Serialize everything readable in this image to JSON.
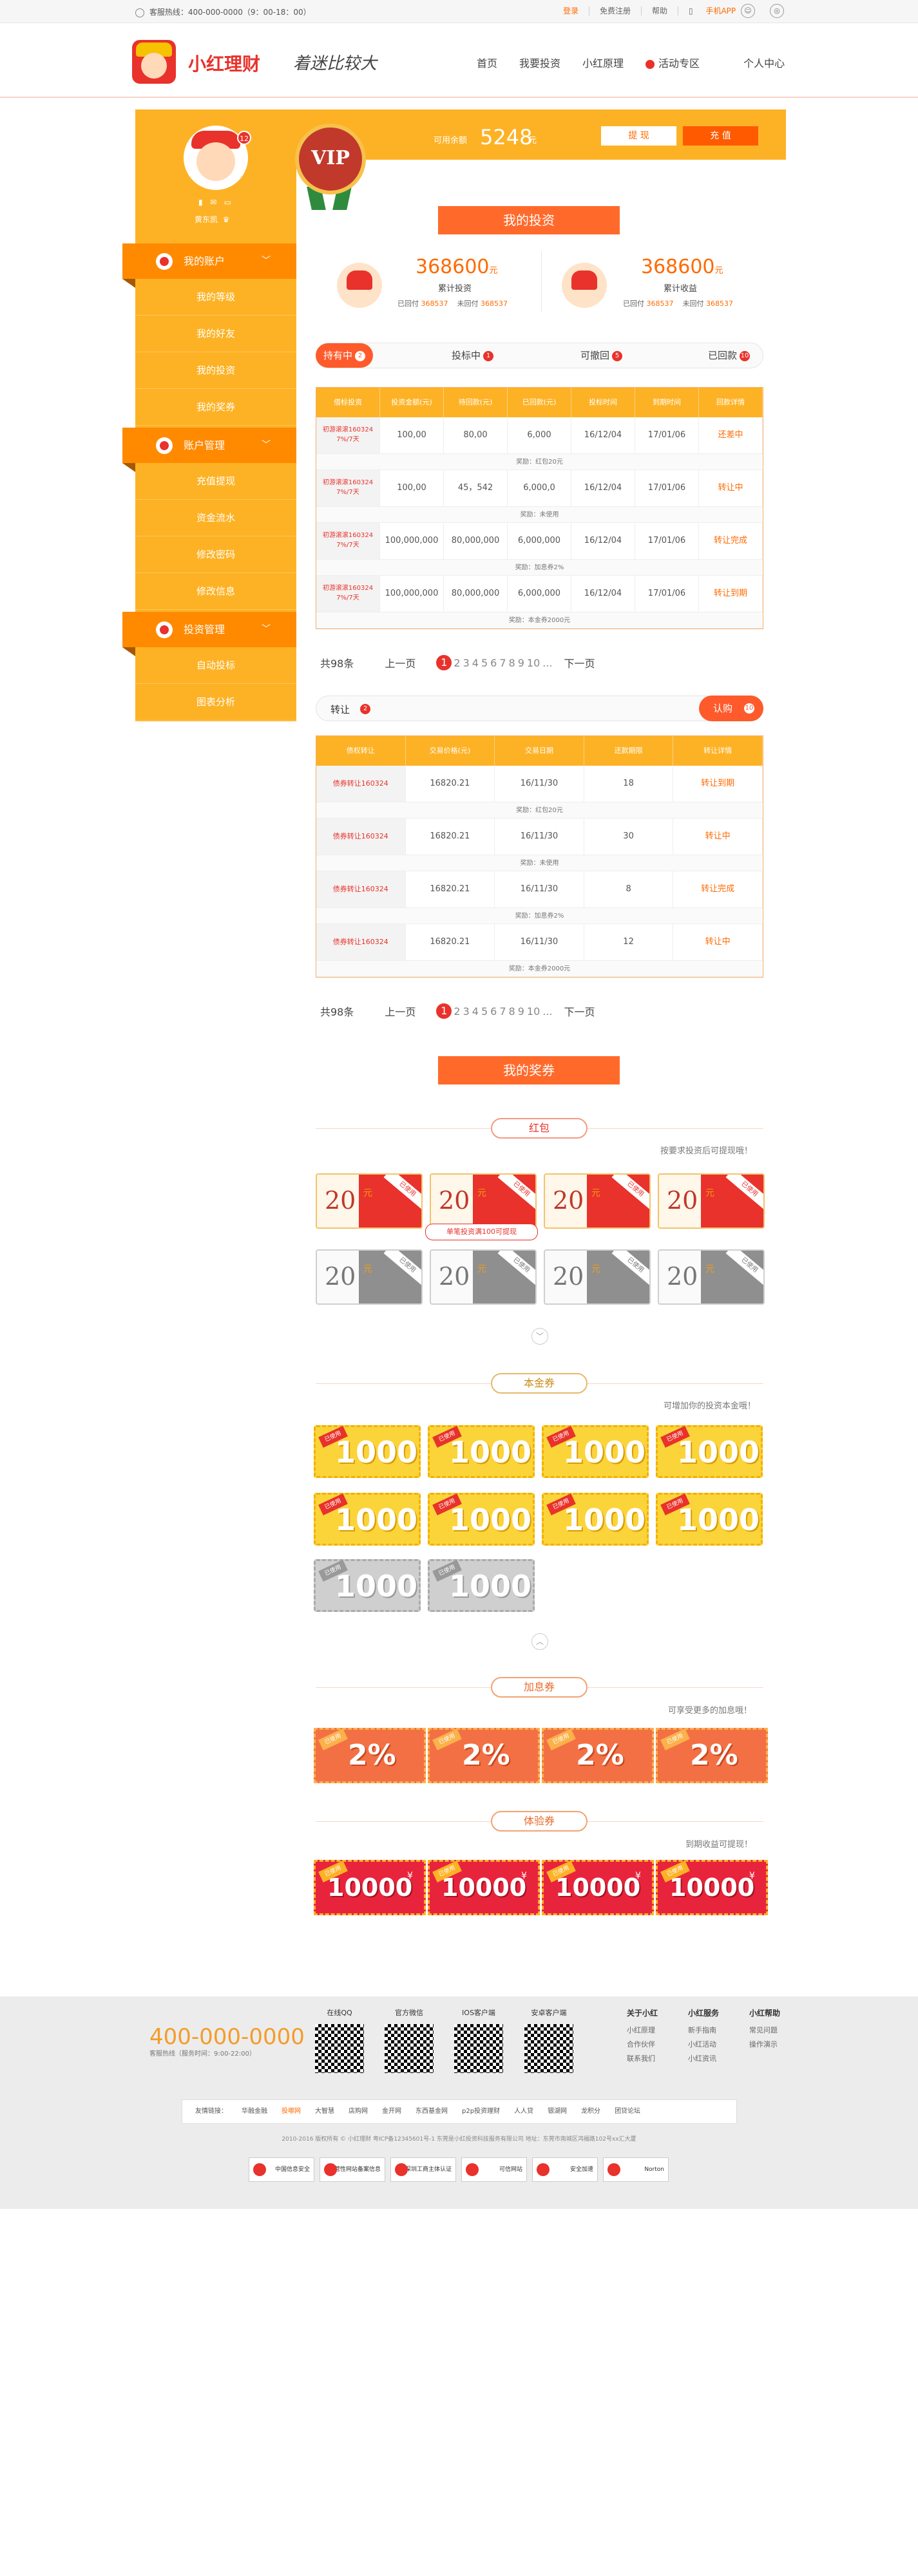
{
  "topbar": {
    "phone": "客服热线：400-000-0000（9：00-18：00）",
    "links": [
      "登录",
      "免费注册",
      "帮助",
      "手机APP"
    ]
  },
  "header": {
    "logo_text": "小红理财",
    "slogan": "着迷比较大",
    "nav": [
      "首页",
      "我要投资",
      "小红原理",
      "活动专区",
      "个人中心"
    ]
  },
  "sidebar": {
    "avatar_badge": "12",
    "username": "黄东凯",
    "account_menu": {
      "title": "我的账户",
      "items": [
        "我的等级",
        "我的好友",
        "我的投资",
        "我的奖券"
      ]
    },
    "manage_menu": {
      "title": "账户管理",
      "items": [
        "充值提现",
        "资金流水",
        "修改密码",
        "修改信息"
      ]
    },
    "invest_menu": {
      "title": "投资管理",
      "items": [
        "自动投标",
        "图表分析"
      ]
    }
  },
  "balance": {
    "label": "可用余额",
    "value": "5248",
    "unit": "元",
    "withdraw_label": "提 现",
    "recharge_label": "充 值",
    "vip_text": "VIP"
  },
  "my_invest": {
    "title": "我的投资",
    "summary": [
      {
        "value": "368600",
        "unit": "元",
        "label": "累计投资",
        "sub1_label": "已回付",
        "sub1": "368537",
        "sub2_label": "未回付",
        "sub2": "368537"
      },
      {
        "value": "368600",
        "unit": "元",
        "label": "累计收益",
        "sub1_label": "已回付",
        "sub1": "368537",
        "sub2_label": "未回付",
        "sub2": "368537"
      }
    ],
    "tabs": [
      {
        "label": "持有中",
        "count": "2"
      },
      {
        "label": "投标中",
        "count": "1"
      },
      {
        "label": "可撤回",
        "count": "5"
      },
      {
        "label": "已回款",
        "count": "10"
      }
    ],
    "table_headers": [
      "借标投资",
      "投资金额(元)",
      "待回款(元)",
      "已回款(元)",
      "投标时间",
      "到期时间",
      "回款详情"
    ],
    "rows": [
      {
        "name": "初游滚滚160324\n7%/7天",
        "amount": "100,00",
        "pending": "80,00",
        "returned": "6,000",
        "start": "16/12/04",
        "end": "17/01/06",
        "status": "还差中",
        "note": "奖励：红包20元"
      },
      {
        "name": "初游滚滚160324\n7%/7天",
        "amount": "100,00",
        "pending": "45，542",
        "returned": "6,000,0",
        "start": "16/12/04",
        "end": "17/01/06",
        "status": "转让中",
        "note": "奖励：未使用"
      },
      {
        "name": "初游滚滚160324\n7%/7天",
        "amount": "100,000,000",
        "pending": "80,000,000",
        "returned": "6,000,000",
        "start": "16/12/04",
        "end": "17/01/06",
        "status": "转让完成",
        "note": "奖励：加息券2%"
      },
      {
        "name": "初游滚滚160324\n7%/7天",
        "amount": "100,000,000",
        "pending": "80,000,000",
        "returned": "6,000,000",
        "start": "16/12/04",
        "end": "17/01/06",
        "status": "转让到期",
        "note": "奖励：本金券2000元"
      }
    ],
    "pager": {
      "total": "共98条",
      "prev": "上一页",
      "current": "1",
      "pages": [
        "2",
        "3",
        "4",
        "5",
        "6",
        "7",
        "8",
        "9",
        "10"
      ],
      "ellipsis": "...",
      "next": "下一页"
    }
  },
  "transfer": {
    "label": "转让",
    "count": "2",
    "buy_label": "认购",
    "buy_count": "10",
    "table_headers": [
      "债权转让",
      "交易价格(元)",
      "交易日期",
      "还款期限",
      "转让详情"
    ],
    "rows": [
      {
        "name": "债券转让160324",
        "price": "16820.21",
        "date": "16/11/30",
        "term": "18",
        "status": "转让到期",
        "note": "奖励：红包20元"
      },
      {
        "name": "债券转让160324",
        "price": "16820.21",
        "date": "16/11/30",
        "term": "30",
        "status": "转让中",
        "note": "奖励：未使用"
      },
      {
        "name": "债券转让160324",
        "price": "16820.21",
        "date": "16/11/30",
        "term": "8",
        "status": "转让完成",
        "note": "奖励：加息券2%"
      },
      {
        "name": "债券转让160324",
        "price": "16820.21",
        "date": "16/11/30",
        "term": "12",
        "status": "转让中",
        "note": "奖励：本金券2000元"
      }
    ],
    "pager": {
      "total": "共98条",
      "prev": "上一页",
      "current": "1",
      "pages": [
        "2",
        "3",
        "4",
        "5",
        "6",
        "7",
        "8",
        "9",
        "10"
      ],
      "ellipsis": "...",
      "next": "下一页"
    }
  },
  "coupons": {
    "title": "我的奖券",
    "red": {
      "label": "红包",
      "hint": "按要求投资后可提现哦！",
      "value": "20",
      "unit": "元",
      "tooltip": "单笔投资满100可提现",
      "tag": "已使用"
    },
    "principal": {
      "label": "本金券",
      "hint": "可增加你的投资本金哦！",
      "value": "1000",
      "tag": "已使用"
    },
    "interest": {
      "label": "加息券",
      "hint": "可享受更多的加息哦！",
      "value": "2%",
      "tag": "已使用"
    },
    "trial": {
      "label": "体验券",
      "hint": "到期收益可提现！",
      "value": "10000",
      "unit": "¥",
      "tag": "已使用"
    }
  },
  "footer": {
    "phone": "400-000-0000",
    "hours": "客服热线（服务时间：9:00-22:00）",
    "qr_titles": [
      "在线QQ",
      "官方微信",
      "IOS客户端",
      "安卓客户端"
    ],
    "col1": {
      "title": "关于小红",
      "items": [
        "小红原理",
        "合作伙伴",
        "联系我们"
      ]
    },
    "col2": {
      "title": "小红服务",
      "items": [
        "新手指南",
        "小红活动",
        "小红资讯"
      ]
    },
    "col3": {
      "title": "小红帮助",
      "items": [
        "常见问题",
        "操作演示"
      ]
    },
    "links_label": "友情链接：",
    "links": [
      "华融金融",
      "投哪网",
      "大智慧",
      "店购网",
      "金开网",
      "东西基金网",
      "p2p投资理财",
      "人人贷",
      "银湖网",
      "龙积分",
      "团贷论坛"
    ],
    "copyright": "2010-2016 版权所有 © 小红理财 粤ICP备12345601号-1  东莞是小红投资科技服务有限公司    地址：东莞市南城区鸿福路102号xx汇大厦",
    "certs": [
      "中国信息安全",
      "经营性网站备案信息",
      "深圳工商主体认证",
      "可信网站",
      "安全加速",
      "Norton"
    ]
  }
}
